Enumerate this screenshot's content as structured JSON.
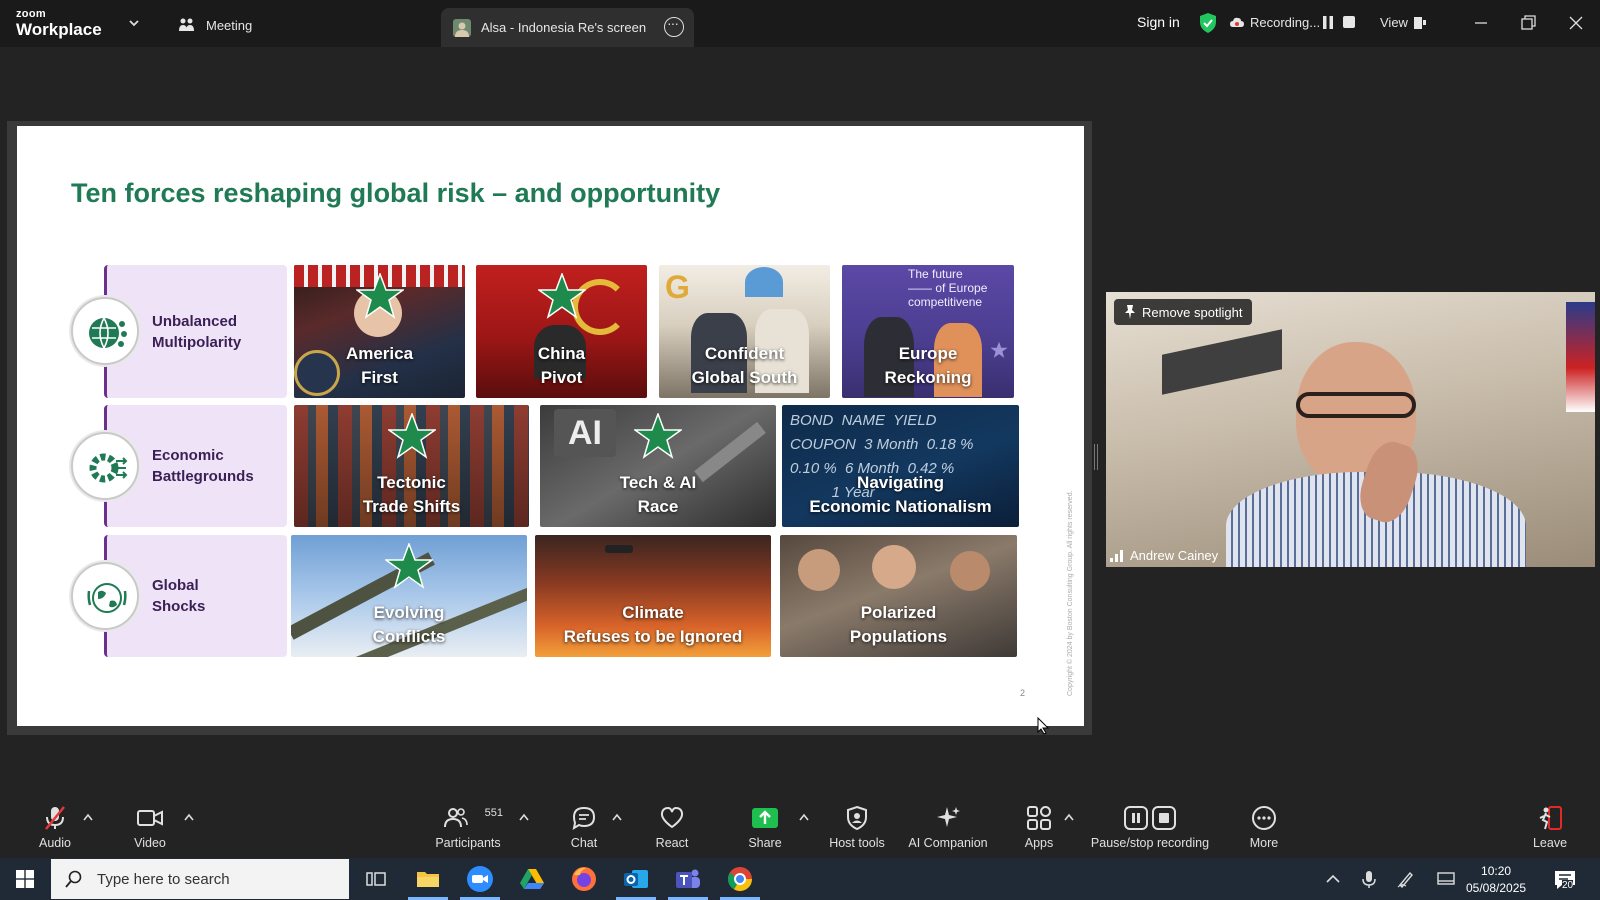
{
  "app": {
    "logo_top": "zoom",
    "logo_bottom": "Workplace",
    "tab_meeting": "Meeting",
    "tab_screen": "Alsa - Indonesia Re's screen",
    "sign_in": "Sign in",
    "recording": "Recording...",
    "view": "View"
  },
  "slide": {
    "title": "Ten forces reshaping global risk – and opportunity",
    "page_number": "2",
    "copyright": "Copyright © 2024 by Boston Consulting Group. All rights reserved.",
    "rows": [
      {
        "label": "Unbalanced\nMultipolarity",
        "tiles": [
          "America\nFirst",
          "China\nPivot",
          "Confident\nGlobal South",
          "Europe\nReckoning"
        ]
      },
      {
        "label": "Economic\nBattlegrounds",
        "tiles": [
          "Tectonic\nTrade Shifts",
          "Tech & AI\nRace",
          "Navigating\nEconomic Nationalism"
        ]
      },
      {
        "label": "Global\nShocks",
        "tiles": [
          "Evolving\nConflicts",
          "Climate\nRefuses to be Ignored",
          "Polarized\nPopulations"
        ]
      }
    ],
    "tile_text_europe": "The future\n—— of Europe\ncompetitivene",
    "tile_text_bond": "BOND  NAME  YIELD\nCOUPON  3 Month  0.18 %\n0.10 %  6 Month  0.42 %\n          1 Year",
    "tile_text_ai": "AI"
  },
  "video": {
    "spotlight": "Remove spotlight",
    "name": "Andrew Cainey"
  },
  "toolbar": {
    "audio": "Audio",
    "video": "Video",
    "participants": "Participants",
    "participants_count": "551",
    "chat": "Chat",
    "react": "React",
    "share": "Share",
    "host_tools": "Host tools",
    "ai_companion": "AI Companion",
    "apps": "Apps",
    "pause_stop": "Pause/stop recording",
    "more": "More",
    "leave": "Leave"
  },
  "taskbar": {
    "search_placeholder": "Type here to search",
    "time": "10:20",
    "date": "05/08/2025",
    "notifications": "20"
  },
  "colors": {
    "title_green": "#1f7a55",
    "label_purple_bg": "#efe4f7",
    "label_purple_bar": "#6b2f8f",
    "star_green": "#1e8a4c",
    "share_green": "#1fbf4f",
    "leave_red": "#e02a2a"
  }
}
